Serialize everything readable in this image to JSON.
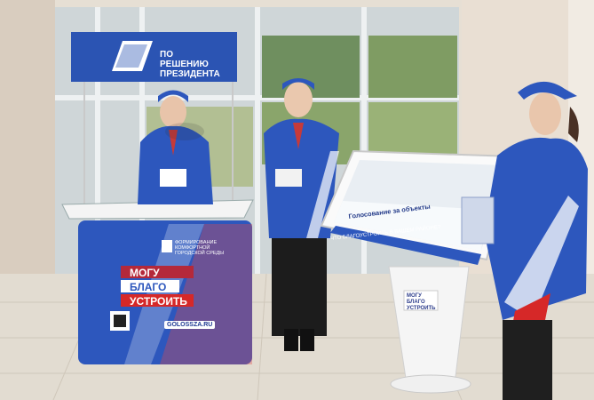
{
  "banner": {
    "subtitle": "ПО РЕШЕНИЮ ПРЕЗИДЕНТА"
  },
  "podium": {
    "logo_line1": "МОГУ",
    "logo_line2": "БЛАГО",
    "logo_line3": "УСТРОИТЬ",
    "program_text": "ФОРМИРОВАНИЕ КОМФОРТНОЙ ГОРОДСКОЙ СРЕДЫ",
    "url": "GOLOSSZA.RU"
  },
  "kiosk": {
    "screen_title": "Голосование за объекты",
    "bottom_strip": "ЧТО БЛАГОУСТРОИТЬ В ВАШЕМ РАЙОНЕ?",
    "stand_logo": "МОГУ БЛАГО УСТРОИТЬ"
  },
  "colors": {
    "brand_blue": "#1f4fa8",
    "brand_red": "#d62828",
    "wall": "#e8e1d6"
  }
}
